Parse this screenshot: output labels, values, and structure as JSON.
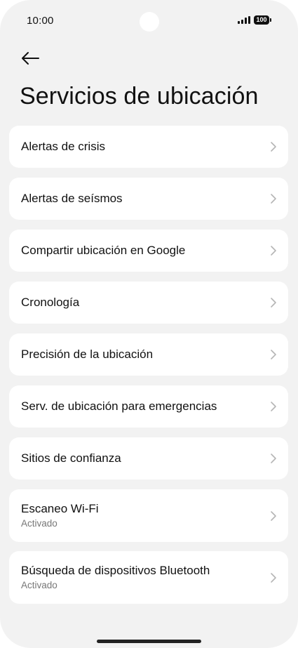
{
  "status_bar": {
    "time": "10:00",
    "battery": "100"
  },
  "header": {
    "title": "Servicios de ubicación"
  },
  "items": [
    {
      "label": "Alertas de crisis"
    },
    {
      "label": "Alertas de seísmos"
    },
    {
      "label": "Compartir ubicación en Google"
    },
    {
      "label": "Cronología"
    },
    {
      "label": "Precisión de la ubicación"
    },
    {
      "label": "Serv. de ubicación para emergencias"
    },
    {
      "label": "Sitios de confianza"
    },
    {
      "label": "Escaneo Wi-Fi",
      "sublabel": "Activado"
    },
    {
      "label": "Búsqueda de dispositivos Bluetooth",
      "sublabel": "Activado"
    }
  ],
  "icons": {
    "back": "arrow-left-icon",
    "chevron": "chevron-right-icon",
    "signal": "signal-icon",
    "battery": "battery-icon"
  },
  "colors": {
    "background": "#f2f2f2",
    "card": "#ffffff",
    "text": "#111111",
    "subtext": "#777777",
    "chevron": "#b5b5b5"
  }
}
